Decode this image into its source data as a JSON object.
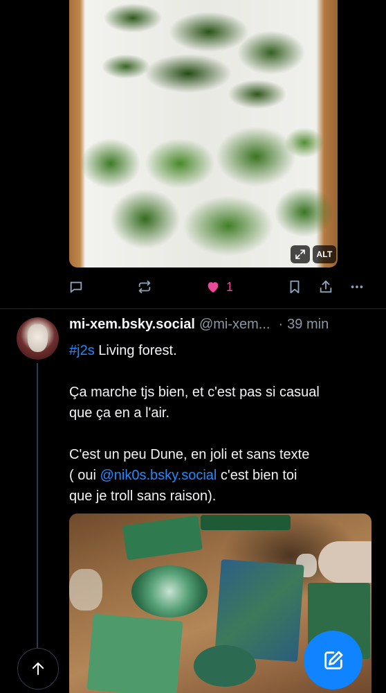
{
  "first_post": {
    "image": {
      "alt_badge": "ALT",
      "expand_icon": "expand-icon"
    },
    "actions": {
      "reply_icon": "reply-icon",
      "repost_icon": "repost-icon",
      "like_icon": "heart-filled-icon",
      "like_count": "1",
      "bookmark_icon": "bookmark-icon",
      "share_icon": "share-icon",
      "more_icon": "more-icon"
    }
  },
  "second_post": {
    "display_name": "mi-xem.bsky.social",
    "handle": "@mi-xem...",
    "separator": "·",
    "time": "39 min",
    "text": {
      "hashtag": "#j2s",
      "line1_rest": " Living forest.",
      "line2": "Ça marche tjs bien, et c'est pas si casual",
      "line3": "que ça en a l'air.",
      "line4": "C'est un peu Dune, en joli et sans texte",
      "line5_pre": "( oui ",
      "mention": "@nik0s.bsky.social",
      "line5_post": " c'est bien toi",
      "line6": "que je troll sans raison)."
    }
  },
  "floating": {
    "scroll_top_icon": "arrow-up-icon",
    "compose_icon": "compose-icon"
  },
  "colors": {
    "background": "#000000",
    "text": "#f1f3f5",
    "muted": "#8b98a5",
    "link": "#208bfe",
    "like": "#ec4899",
    "compose": "#1083fe",
    "icon": "#8da5bf"
  }
}
